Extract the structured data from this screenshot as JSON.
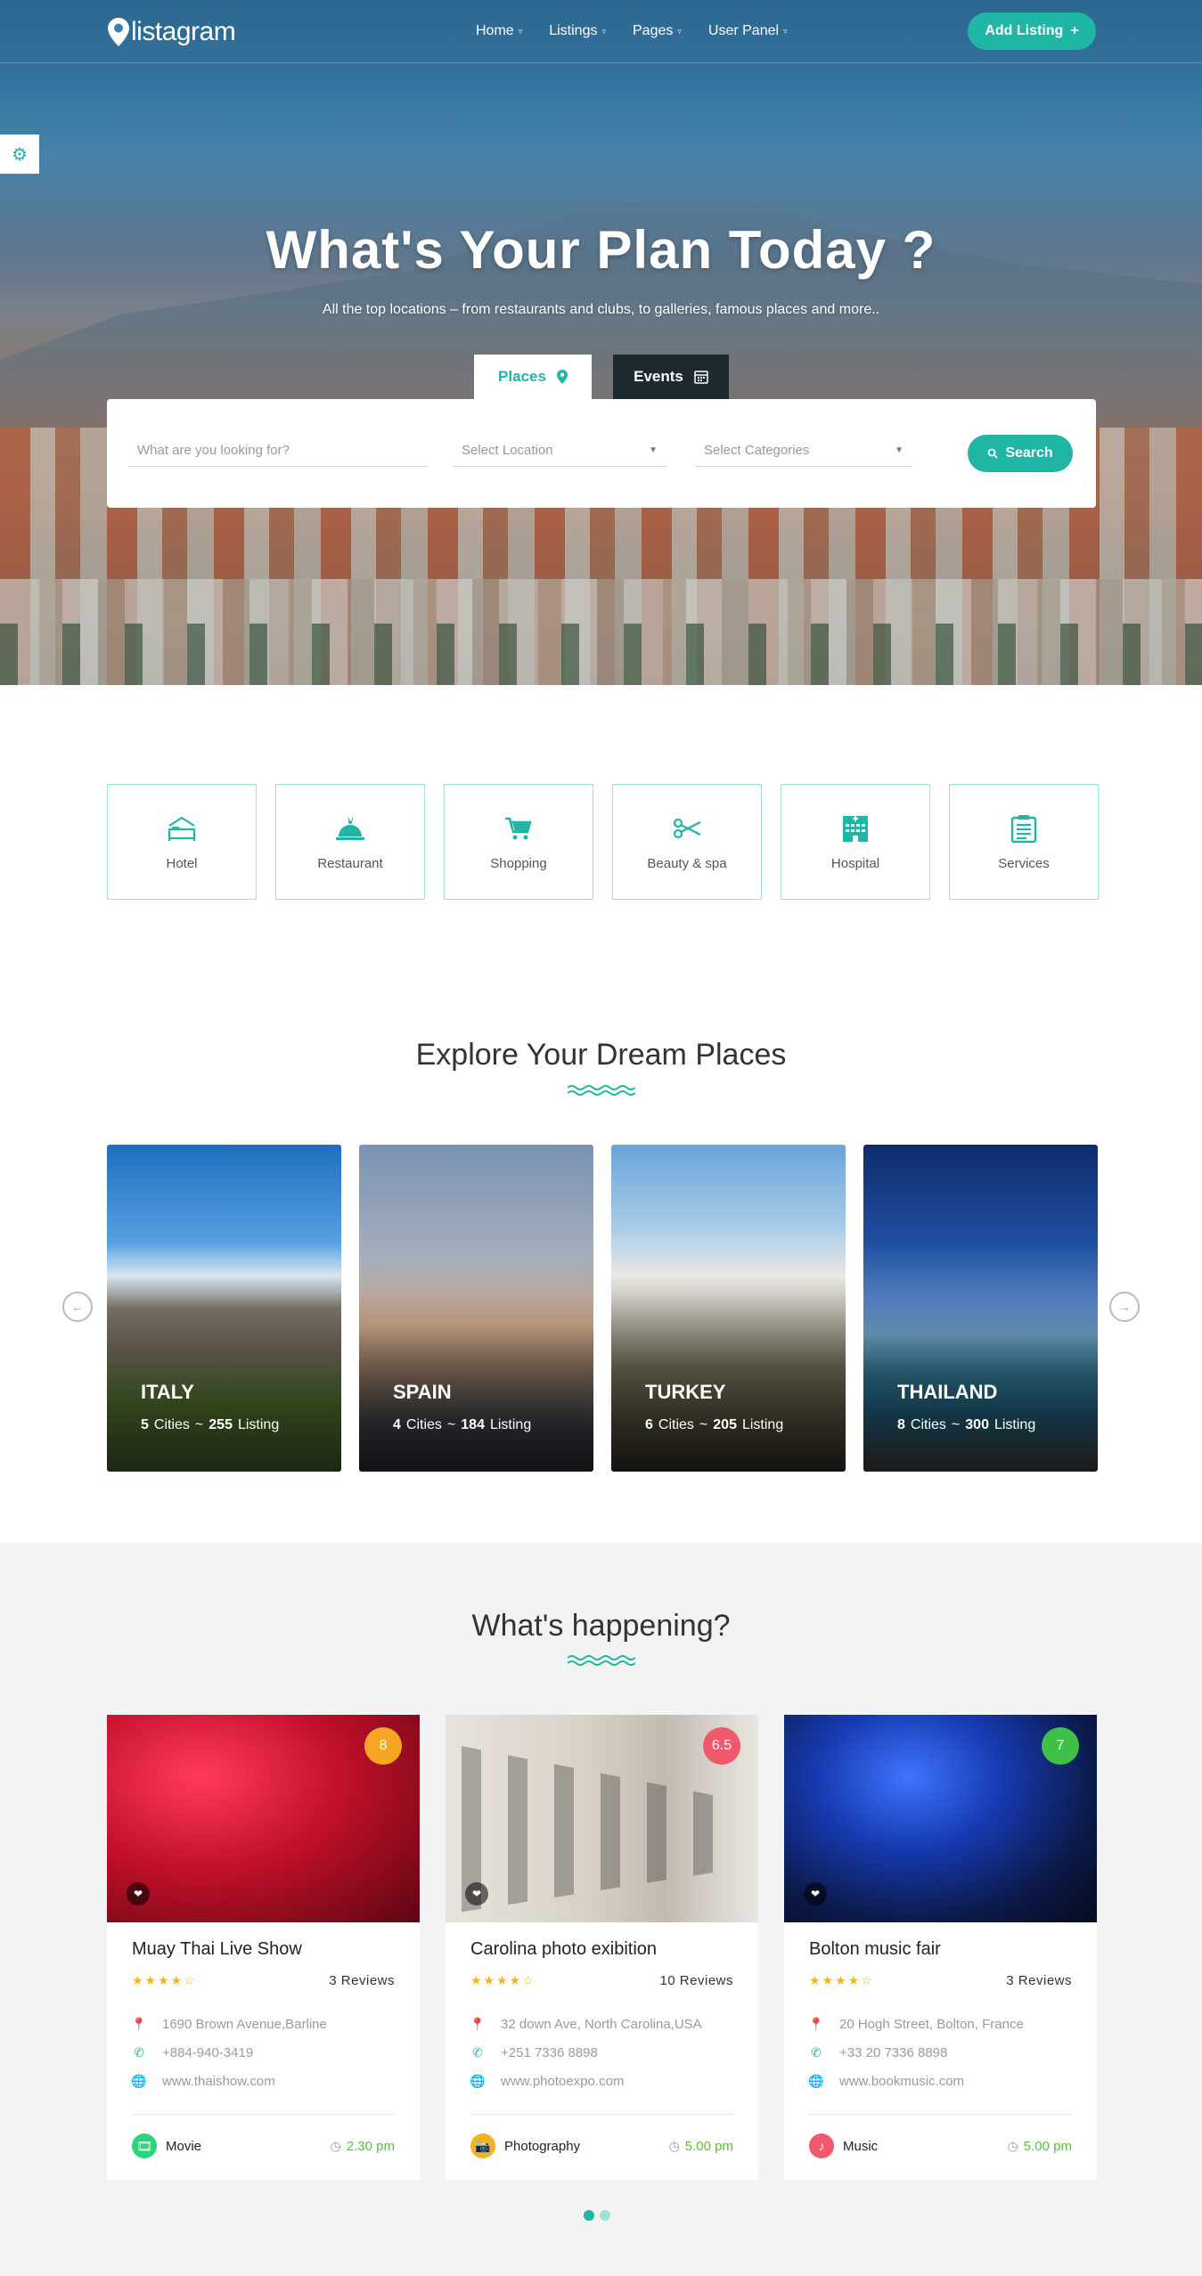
{
  "nav": {
    "logo": "listagram",
    "menu": [
      {
        "label": "Home"
      },
      {
        "label": "Listings"
      },
      {
        "label": "Pages"
      },
      {
        "label": "User Panel"
      }
    ],
    "add_listing": "Add Listing"
  },
  "hero": {
    "title": "What's Your Plan Today ?",
    "subtitle": "All the top locations – from restaurants and clubs, to galleries, famous places and more..",
    "tabs": [
      {
        "label": "Places",
        "icon": "map-pin-icon"
      },
      {
        "label": "Events",
        "icon": "calendar-icon"
      }
    ],
    "search": {
      "what_placeholder": "What are you looking for?",
      "location_placeholder": "Select Location",
      "category_placeholder": "Select Categories",
      "button": "Search"
    }
  },
  "categories": [
    {
      "label": "Hotel",
      "icon": "bed-icon"
    },
    {
      "label": "Restaurant",
      "icon": "cloche-icon"
    },
    {
      "label": "Shopping",
      "icon": "cart-icon"
    },
    {
      "label": "Beauty & spa",
      "icon": "scissors-icon"
    },
    {
      "label": "Hospital",
      "icon": "hospital-icon"
    },
    {
      "label": "Services",
      "icon": "clipboard-icon"
    }
  ],
  "explore": {
    "title": "Explore Your Dream Places",
    "places": [
      {
        "name": "ITALY",
        "cities": "5",
        "listing": "255"
      },
      {
        "name": "SPAIN",
        "cities": "4",
        "listing": "184"
      },
      {
        "name": "TURKEY",
        "cities": "6",
        "listing": "205"
      },
      {
        "name": "THAILAND",
        "cities": "8",
        "listing": "300"
      }
    ],
    "cities_word": "Cities",
    "sep": "~",
    "listing_word": "Listing"
  },
  "happening": {
    "title": "What's happening?",
    "events": [
      {
        "title": "Muay Thai Live Show",
        "score": "8",
        "score_color": "#f5a623",
        "stars": "★★★★☆",
        "reviews": "3 Reviews",
        "address": "1690 Brown Avenue,Barline",
        "phone": "+884-940-3419",
        "web": "www.thaishow.com",
        "category": "Movie",
        "cat_color": "#2bd67b",
        "time": "2.30 pm"
      },
      {
        "title": "Carolina photo exibition",
        "score": "6.5",
        "score_color": "#f0596b",
        "stars": "★★★★☆",
        "reviews": "10 Reviews",
        "address": "32 down Ave, North Carolina,USA",
        "phone": "+251 7336 8898",
        "web": "www.photoexpo.com",
        "category": "Photography",
        "cat_color": "#f5b21b",
        "time": "5.00 pm"
      },
      {
        "title": "Bolton music fair",
        "score": "7",
        "score_color": "#3fc046",
        "stars": "★★★★☆",
        "reviews": "3 Reviews",
        "address": "20 Hogh Street, Bolton, France",
        "phone": "+33 20 7336 8898",
        "web": "www.bookmusic.com",
        "category": "Music",
        "cat_color": "#f0596b",
        "time": "5.00 pm"
      }
    ]
  },
  "colors": {
    "accent": "#1fb6a6",
    "dark": "#1e2a30"
  }
}
